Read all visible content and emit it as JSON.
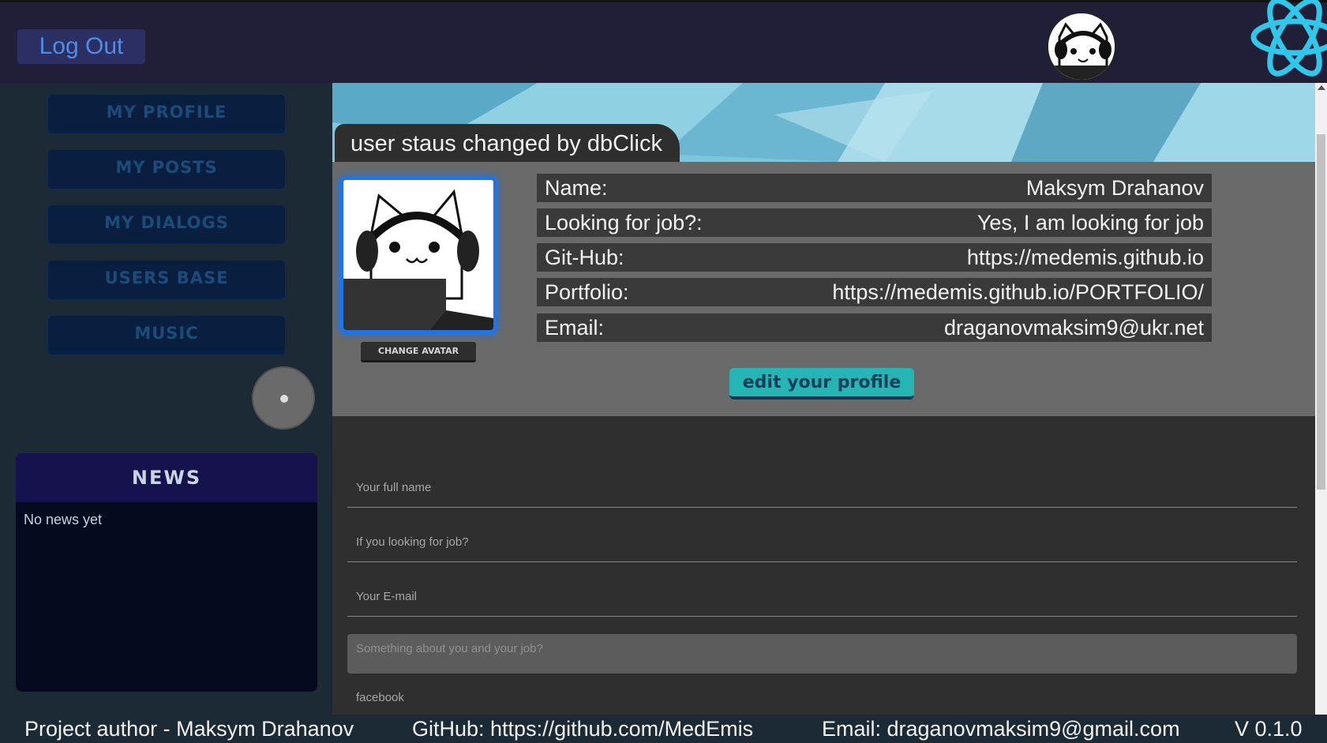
{
  "header": {
    "logout_label": "Log Out"
  },
  "sidebar": {
    "nav": [
      {
        "label": "MY PROFILE"
      },
      {
        "label": "MY POSTS"
      },
      {
        "label": "MY DIALOGS"
      },
      {
        "label": "USERS BASE"
      },
      {
        "label": "MUSIC"
      }
    ],
    "news": {
      "title": "NEWS",
      "body": "No news yet"
    }
  },
  "profile": {
    "status_text": "user staus changed by dbClick",
    "change_avatar_label": "CHANGE AVATAR",
    "rows": [
      {
        "label": "Name:",
        "value": "Maksym Drahanov"
      },
      {
        "label": "Looking for job?:",
        "value": "Yes, I am looking for job"
      },
      {
        "label": "Git-Hub:",
        "value": "https://medemis.github.io"
      },
      {
        "label": "Portfolio:",
        "value": "https://medemis.github.io/PORTFOLIO/"
      },
      {
        "label": "Email:",
        "value": "draganovmaksim9@ukr.net"
      }
    ],
    "edit_label": "edit your profile"
  },
  "editor": {
    "full_name_placeholder": "Your full name",
    "job_placeholder": "If you looking for job?",
    "email_placeholder": "Your E-mail",
    "about_placeholder": "Something about you and your job?",
    "facebook_placeholder": "facebook"
  },
  "footer": {
    "author": "Project author - Maksym Drahanov",
    "github": "GitHub: https://github.com/MedEmis",
    "email": "Email: draganovmaksim9@gmail.com",
    "version": "V 0.1.0"
  },
  "colors": {
    "header_bg": "#211f38",
    "sidebar_bg": "#1c2a36",
    "accent_teal": "#26b5b5",
    "avatar_border": "#1f74e6"
  },
  "icons": [
    "cat-avatar-icon",
    "react-logo-icon",
    "sound-toggle-icon"
  ]
}
